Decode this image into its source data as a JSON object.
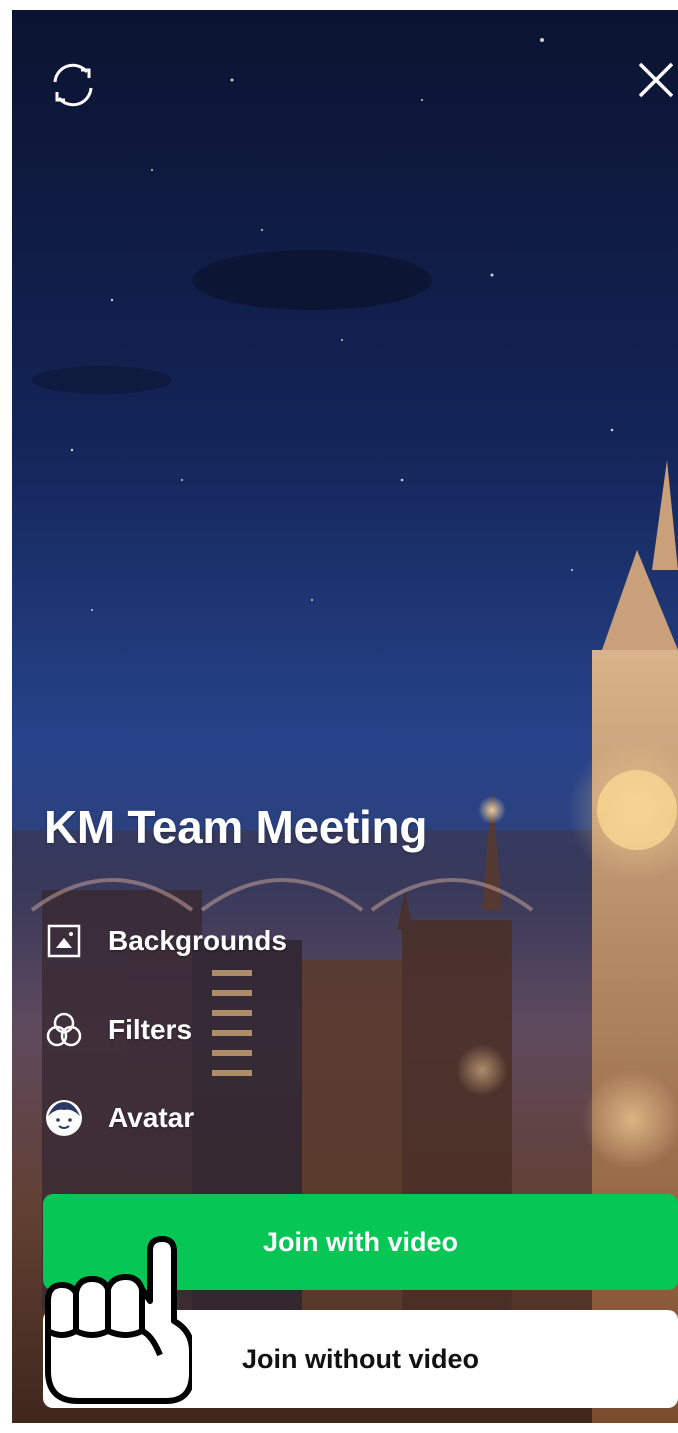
{
  "header": {
    "refresh_icon": "refresh-icon",
    "close_icon": "close-icon"
  },
  "meeting": {
    "title": "KM Team Meeting"
  },
  "options": [
    {
      "label": "Backgrounds",
      "icon": "image-icon"
    },
    {
      "label": "Filters",
      "icon": "filters-icon"
    },
    {
      "label": "Avatar",
      "icon": "avatar-icon"
    }
  ],
  "actions": {
    "join_video_label": "Join with video",
    "join_no_video_label": "Join without video"
  },
  "colors": {
    "accent": "#06c755",
    "secondary_button": "#ffffff"
  }
}
